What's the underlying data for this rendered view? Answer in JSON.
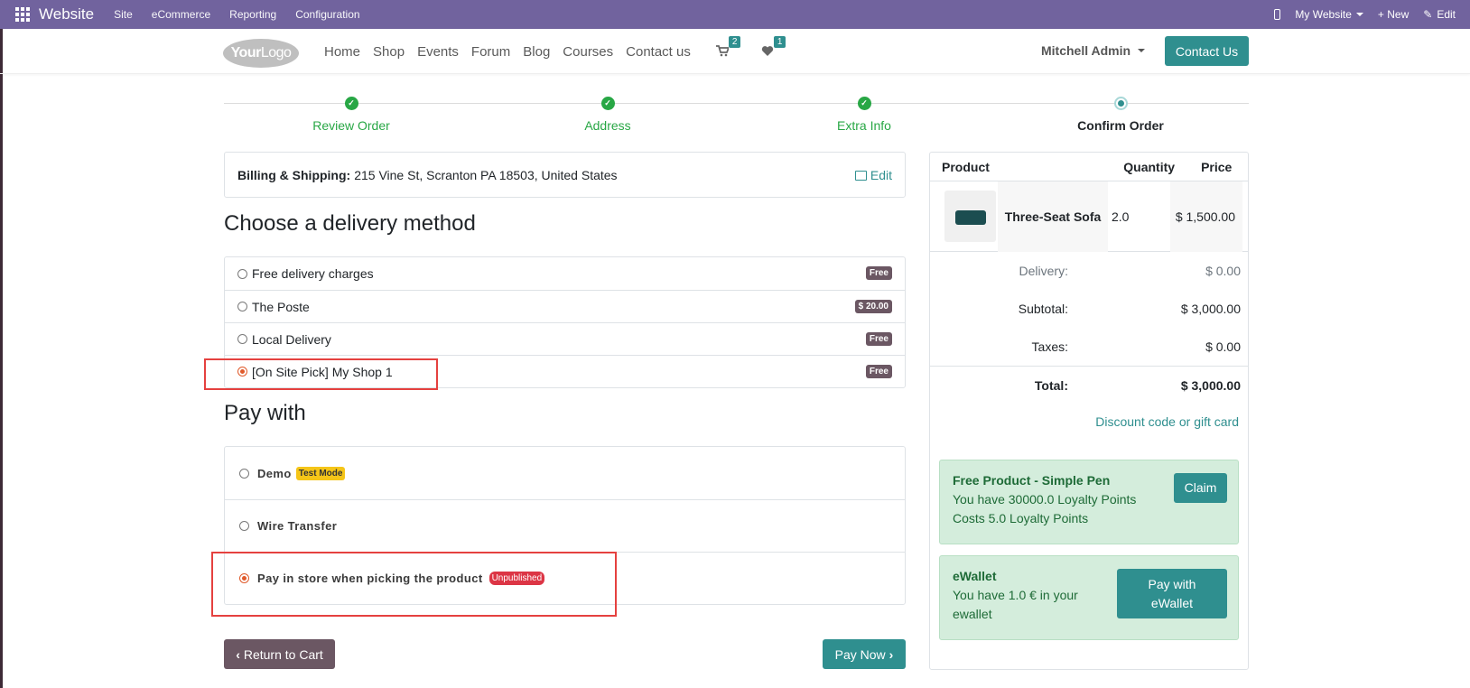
{
  "admin_bar": {
    "app_name": "Website",
    "menus": [
      "Site",
      "eCommerce",
      "Reporting",
      "Configuration"
    ],
    "site_selector": "My Website",
    "new_label": "+ New",
    "edit_label": "Edit"
  },
  "header": {
    "logo_bold": "Your",
    "logo_rest": "Logo",
    "nav": [
      "Home",
      "Shop",
      "Events",
      "Forum",
      "Blog",
      "Courses",
      "Contact us"
    ],
    "cart_count": "2",
    "wishlist_count": "1",
    "user_name": "Mitchell Admin",
    "contact_button": "Contact Us"
  },
  "wizard": {
    "steps": [
      {
        "label": "Review Order",
        "state": "done"
      },
      {
        "label": "Address",
        "state": "done"
      },
      {
        "label": "Extra Info",
        "state": "done"
      },
      {
        "label": "Confirm Order",
        "state": "current"
      }
    ]
  },
  "billing": {
    "label": "Billing & Shipping:",
    "address": "215 Vine St, Scranton PA 18503, United States",
    "edit_label": "Edit"
  },
  "delivery": {
    "heading": "Choose a delivery method",
    "methods": [
      {
        "name": "Free delivery charges",
        "price": "Free",
        "selected": false
      },
      {
        "name": "The Poste",
        "price": "$ 20.00",
        "selected": false
      },
      {
        "name": "Local Delivery",
        "price": "Free",
        "selected": false
      },
      {
        "name": "[On Site Pick] My Shop 1",
        "price": "Free",
        "selected": true
      }
    ]
  },
  "payment": {
    "heading": "Pay with",
    "methods": [
      {
        "name": "Demo",
        "tag": "Test Mode",
        "selected": false
      },
      {
        "name": "Wire Transfer",
        "tag": "",
        "selected": false
      },
      {
        "name": "Pay in store when picking the product",
        "tag": "Unpublished",
        "selected": true
      }
    ]
  },
  "actions": {
    "return_label": "Return to Cart",
    "pay_label": "Pay Now"
  },
  "summary": {
    "columns": [
      "Product",
      "Quantity",
      "Price"
    ],
    "product": {
      "name": "Three-Seat Sofa",
      "quantity": "2.0",
      "price": "$ 1,500.00"
    },
    "delivery_label": "Delivery:",
    "delivery_value": "$ 0.00",
    "subtotal_label": "Subtotal:",
    "subtotal_value": "$ 3,000.00",
    "taxes_label": "Taxes:",
    "taxes_value": "$ 0.00",
    "total_label": "Total:",
    "total_value": "$ 3,000.00",
    "discount_link": "Discount code or gift card"
  },
  "rewards": {
    "free_product": {
      "title": "Free Product - Simple Pen",
      "line1": "You have 30000.0 Loyalty Points",
      "line2": "Costs 5.0 Loyalty Points",
      "button": "Claim"
    },
    "ewallet": {
      "title": "eWallet",
      "line1": "You have 1.0 € in your",
      "line2": "ewallet",
      "button_line1": "Pay with",
      "button_line2": "eWallet"
    }
  },
  "colors": {
    "admin_bar": "#71639e",
    "primary": "#2f8f8f",
    "secondary": "#6b5763",
    "success": "#28a745",
    "highlight_box": "#e5413f"
  }
}
